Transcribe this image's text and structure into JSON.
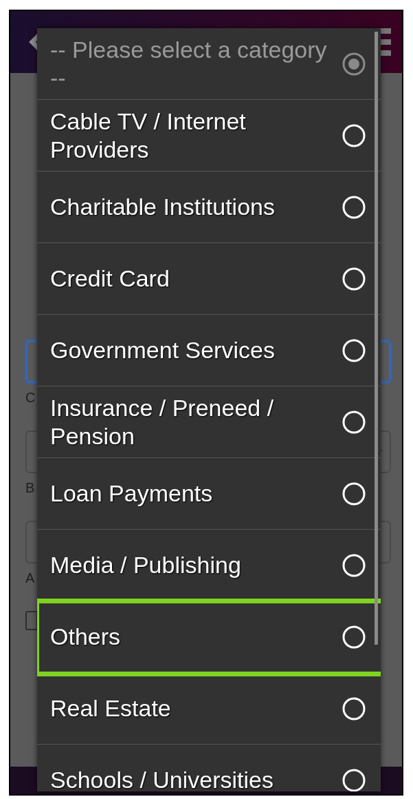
{
  "form": {
    "fields": [
      {
        "kind": "select",
        "focused": true,
        "label": "C"
      },
      {
        "kind": "select",
        "focused": false,
        "label": "B"
      },
      {
        "kind": "text",
        "focused": false,
        "label": "A"
      },
      {
        "kind": "checkbox",
        "checked": false
      }
    ]
  },
  "dialog": {
    "options": [
      {
        "label": "-- Please select a category --",
        "selected": true,
        "disabled": true,
        "highlighted": false
      },
      {
        "label": "Cable TV / Internet Providers",
        "selected": false,
        "disabled": false,
        "highlighted": false
      },
      {
        "label": "Charitable Institutions",
        "selected": false,
        "disabled": false,
        "highlighted": false
      },
      {
        "label": "Credit Card",
        "selected": false,
        "disabled": false,
        "highlighted": false
      },
      {
        "label": "Government Services",
        "selected": false,
        "disabled": false,
        "highlighted": false
      },
      {
        "label": "Insurance / Preneed / Pension",
        "selected": false,
        "disabled": false,
        "highlighted": false
      },
      {
        "label": "Loan Payments",
        "selected": false,
        "disabled": false,
        "highlighted": false
      },
      {
        "label": "Media / Publishing",
        "selected": false,
        "disabled": false,
        "highlighted": false
      },
      {
        "label": "Others",
        "selected": false,
        "disabled": false,
        "highlighted": true
      },
      {
        "label": "Real Estate",
        "selected": false,
        "disabled": false,
        "highlighted": false
      },
      {
        "label": "Schools / Universities",
        "selected": false,
        "disabled": false,
        "highlighted": false
      }
    ]
  }
}
